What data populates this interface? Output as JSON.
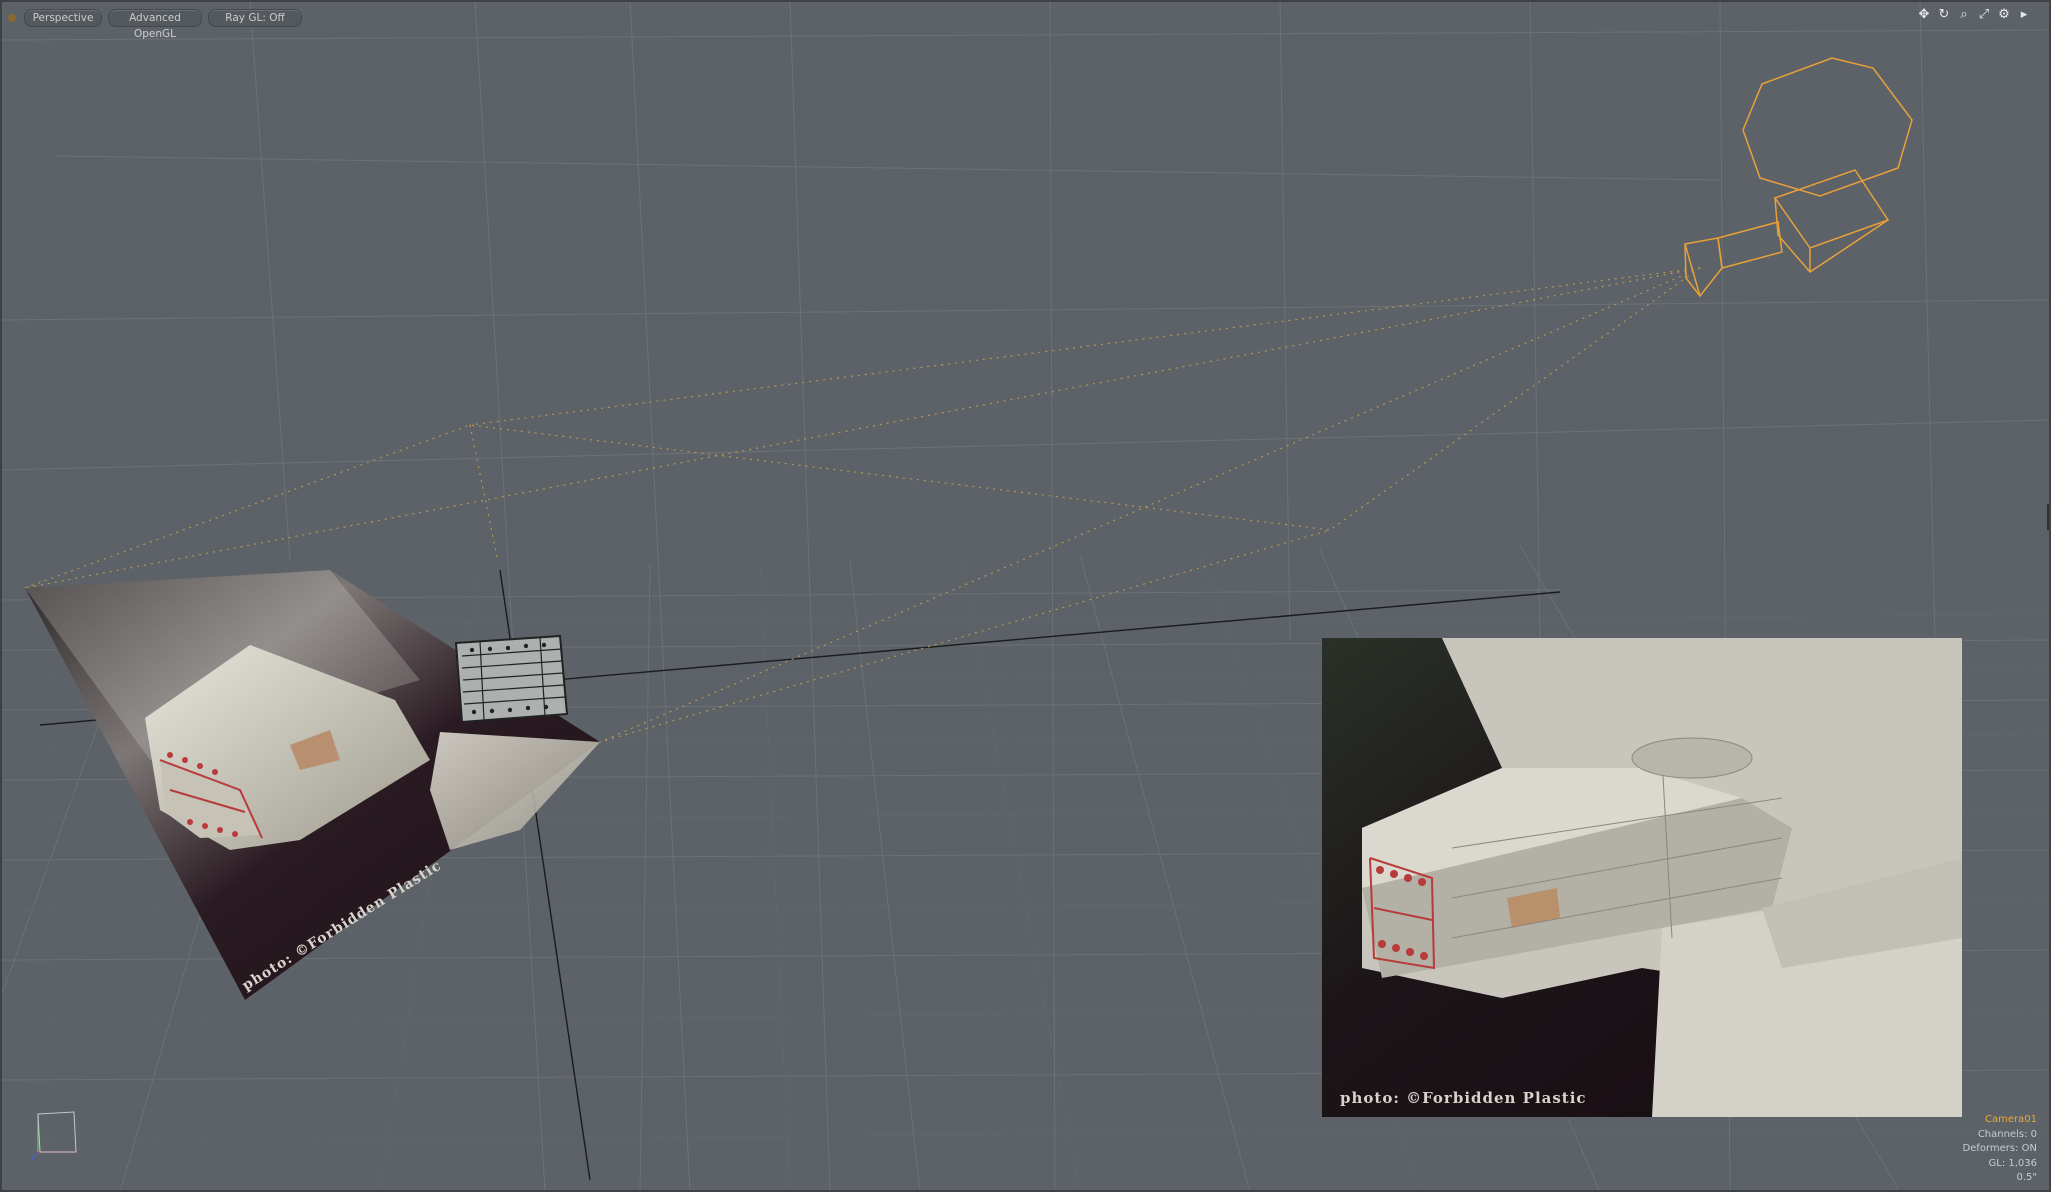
{
  "viewport_bar": {
    "view_mode": "Perspective",
    "render_mode": "Advanced OpenGL",
    "ray_gl": "Ray GL: Off"
  },
  "tools": [
    {
      "name": "move-view-icon",
      "glyph": "✥"
    },
    {
      "name": "rotate-view-icon",
      "glyph": "↻"
    },
    {
      "name": "zoom-view-icon",
      "glyph": "⌕"
    },
    {
      "name": "maximize-view-icon",
      "glyph": "⤢"
    },
    {
      "name": "gear-icon",
      "glyph": "⚙"
    },
    {
      "name": "triangle-right-icon",
      "glyph": "▸"
    }
  ],
  "hud": {
    "camera": "Camera01",
    "channels": "Channels: 0",
    "deformers": "Deformers: ON",
    "gl": "GL: 1,036",
    "scale": "0.5\""
  },
  "overlay": {
    "credit_inset": "photo: ©Forbidden Plastic",
    "credit_plane": "photo: ©Forbidden Plastic"
  },
  "colors": {
    "viewport_bg": "#5c6267",
    "grid_line": "#6f7579",
    "camera_wire": "#e8a03a",
    "hud_camera": "#e8a83a"
  }
}
